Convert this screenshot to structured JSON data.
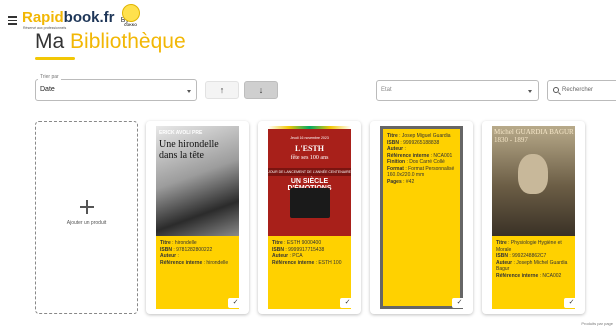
{
  "header": {
    "menu_icon": "hamburger-icon",
    "logo_rapid": "Rapid",
    "logo_book": "book.fr",
    "logo_by": "By",
    "logo_tagline": "Réservé aux professionnels",
    "logo_badge": "COKKO",
    "title_word1": "Ma",
    "title_word2": "Bibliothèque",
    "accent_color": "#f2c705"
  },
  "filters": {
    "sort_legend": "Trier par",
    "sort_value": "Date",
    "sort_up_icon": "↑",
    "sort_down_icon": "↓",
    "state_placeholder": "Etat",
    "search_placeholder": "Rechercher"
  },
  "add_card": {
    "label": "Ajouter un produit"
  },
  "products": [
    {
      "cover_top": "ERICK AVOLI PRE",
      "cover_title": "Une hirondelle dans la tête",
      "info": {
        "title_label": "Titre",
        "title": "hirondelle",
        "isbn_label": "ISBN",
        "isbn": "9781282800222",
        "author_label": "Auteur",
        "author": "",
        "ref_label": "Référence interne",
        "ref": "hirondelle"
      }
    },
    {
      "cover_date": "Jeudi 16 novembre 2023",
      "cover_title": "L'ESTH",
      "cover_subtitle": "fête ses 100 ans",
      "cover_banner": "JOUR DE LANCEMENT DE L'ANNÉE CENTENAIRE",
      "cover_arc": "UN SIÈCLE D'ÉMOTIONS",
      "info": {
        "title_label": "Titre",
        "title": "ESTH 9000400",
        "isbn_label": "ISBN",
        "isbn": "9999917715438",
        "author_label": "Auteur",
        "author": "PCA",
        "ref_label": "Référence interne",
        "ref": "ESTH 100"
      }
    },
    {
      "info": {
        "title_label": "Titre",
        "title": "Josep Miguel Guardia",
        "isbn_label": "ISBN",
        "isbn": "9999265188838",
        "author_label": "Auteur",
        "author": "",
        "ref_label": "Référence interne",
        "ref": "NCA001",
        "finish_label": "Finition",
        "finish": "Dos Carré Collé",
        "format_label": "Format",
        "format": "Format Personnalisé 160.0x220.0 mm",
        "pages_label": "Pages",
        "pages": "#42"
      }
    },
    {
      "cover_title": "Michel GUARDIA BAGUR 1830 - 1897",
      "info": {
        "title_label": "Titre",
        "title": "Physiologie Hygiène et Morale",
        "isbn_label": "ISBN",
        "isbn": "9992248862C7",
        "author_label": "Auteur",
        "author": "Joseph Michel Guardia Bagur",
        "ref_label": "Référence interne",
        "ref": "NCA002"
      }
    }
  ],
  "footer": {
    "text": "Produits par page"
  }
}
